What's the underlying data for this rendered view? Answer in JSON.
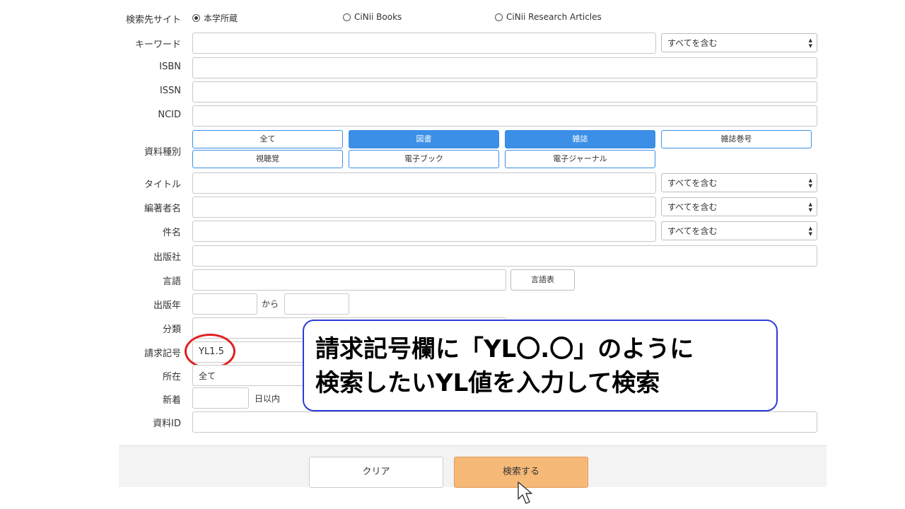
{
  "search_target": {
    "label": "検索先サイト",
    "options": [
      "本学所蔵",
      "CiNii Books",
      "CiNii Research Articles"
    ],
    "selected": "本学所蔵"
  },
  "fields": {
    "keyword": "キーワード",
    "isbn": "ISBN",
    "issn": "ISSN",
    "ncid": "NCID",
    "material_type": "資料種別",
    "title": "タイトル",
    "author": "編著者名",
    "subject": "件名",
    "publisher": "出版社",
    "language": "言語",
    "pub_year": "出版年",
    "classification": "分類",
    "call_number": "請求記号",
    "location": "所在",
    "new_arrivals": "新着",
    "material_id": "資料ID"
  },
  "match_select": "すべてを含む",
  "material_types": [
    {
      "label": "全て",
      "selected": false
    },
    {
      "label": "図書",
      "selected": true
    },
    {
      "label": "雑誌",
      "selected": true
    },
    {
      "label": "雑誌巻号",
      "selected": false
    },
    {
      "label": "視聴覚",
      "selected": false
    },
    {
      "label": "電子ブック",
      "selected": false
    },
    {
      "label": "電子ジャーナル",
      "selected": false
    }
  ],
  "language_table_button": "言語表",
  "year_from_text": "から",
  "call_number_value": "YL1.5",
  "location_value": "全て",
  "days_within_text": "日以内",
  "buttons": {
    "clear": "クリア",
    "search": "検索する"
  },
  "callout": {
    "line1": "請求記号欄に「YL〇.〇」のように",
    "line2": "検索したいYL値を入力して検索"
  },
  "colors": {
    "accent": "#3b8fe6",
    "search_button": "#f7b978",
    "callout_border": "#2a3bd9",
    "highlight_circle": "#e02020"
  }
}
